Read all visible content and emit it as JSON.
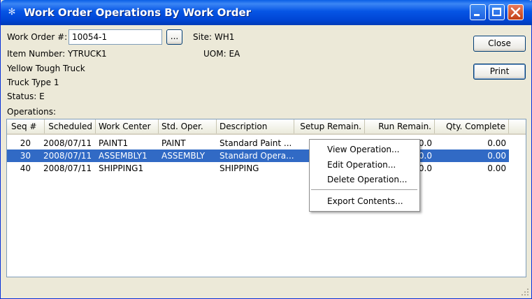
{
  "window": {
    "title": "Work Order Operations By Work Order",
    "app_icon": "cluster-icon"
  },
  "form": {
    "work_order_label": "Work Order #:",
    "work_order_value": "10054-1",
    "lookup_label": "...",
    "site_label": "Site: WH1",
    "item_number": "Item Number: YTRUCK1",
    "uom": "UOM: EA",
    "item_desc1": "Yellow Tough Truck",
    "item_desc2": "Truck Type 1",
    "status": "Status: E",
    "operations_label": "Operations:"
  },
  "buttons": {
    "close": "Close",
    "print": "Print"
  },
  "table": {
    "columns": [
      "Seq #",
      "Scheduled",
      "Work Center",
      "Std. Oper.",
      "Description",
      "Setup Remain.",
      "Run Remain.",
      "Qty. Complete"
    ],
    "rows": [
      {
        "seq": "20",
        "scheduled": "2008/07/11",
        "work_center": "PAINT1",
        "std_oper": "PAINT",
        "description": "Standard Paint ...",
        "setup": "",
        "run": ".0.0",
        "qty": "0.00"
      },
      {
        "seq": "30",
        "scheduled": "2008/07/11",
        "work_center": "ASSEMBLY1",
        "std_oper": "ASSEMBLY",
        "description": "Standard Opera...",
        "setup": "",
        "run": ".0.0",
        "qty": "0.00"
      },
      {
        "seq": "40",
        "scheduled": "2008/07/11",
        "work_center": "SHIPPING1",
        "std_oper": "",
        "description": "SHIPPING",
        "setup": "",
        "run": ".0.0",
        "qty": "0.00"
      }
    ],
    "selected_row": 1
  },
  "context_menu": {
    "items": [
      "View Operation...",
      "Edit Operation...",
      "Delete Operation...",
      "Export Contents..."
    ]
  }
}
